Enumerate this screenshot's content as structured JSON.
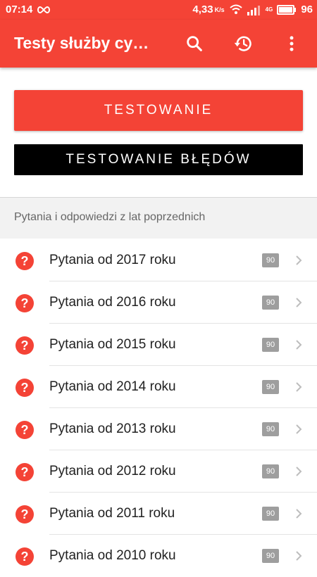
{
  "status_bar": {
    "time": "07:14",
    "speed": "4,33",
    "speed_unit": "K/s",
    "network": "4G",
    "battery": "96"
  },
  "app_bar": {
    "title": "Testy służby cy…",
    "icons": [
      "search-icon",
      "history-icon",
      "more-vert-icon"
    ]
  },
  "buttons": {
    "testing": "TESTOWANIE",
    "error_testing": "TESTOWANIE BŁĘDÓW"
  },
  "section": {
    "header": "Pytania i odpowiedzi z lat poprzednich"
  },
  "items": [
    {
      "label": "Pytania od 2017 roku",
      "count": "90"
    },
    {
      "label": "Pytania od 2016 roku",
      "count": "90"
    },
    {
      "label": "Pytania od 2015 roku",
      "count": "90"
    },
    {
      "label": "Pytania od 2014 roku",
      "count": "90"
    },
    {
      "label": "Pytania od 2013 roku",
      "count": "90"
    },
    {
      "label": "Pytania od 2012 roku",
      "count": "90"
    },
    {
      "label": "Pytania od 2011 roku",
      "count": "90"
    },
    {
      "label": "Pytania od 2010 roku",
      "count": "90"
    }
  ],
  "colors": {
    "primary": "#f44336",
    "dark_button": "#000000",
    "badge": "#9e9e9e",
    "section_bg": "#f2f2f2"
  }
}
